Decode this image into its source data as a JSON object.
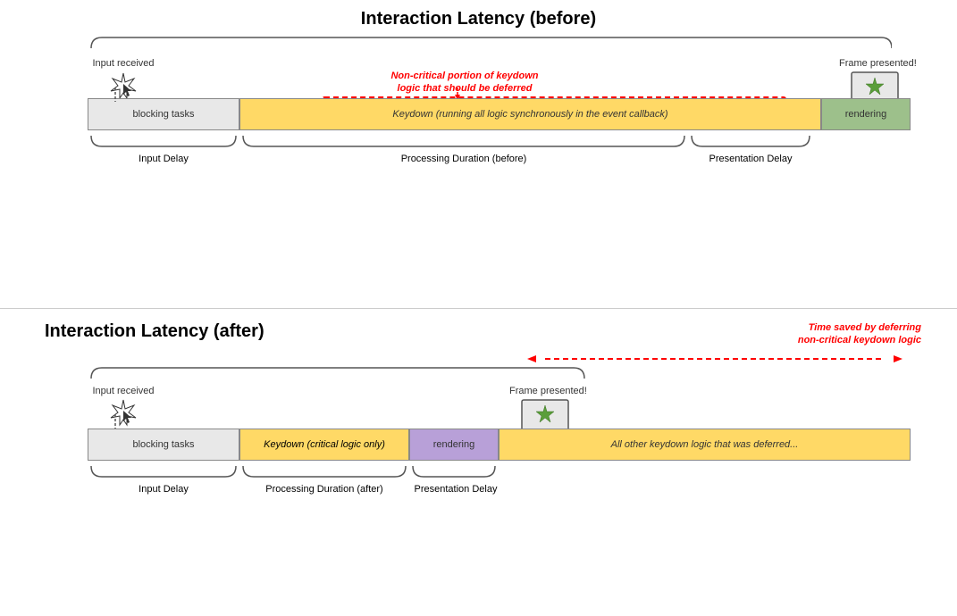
{
  "before": {
    "title": "Interaction Latency (before)",
    "input_received": "Input received",
    "frame_presented": "Frame presented!",
    "blocking_label": "blocking tasks",
    "keydown_label": "Keydown (running all logic synchronously in the event callback)",
    "rendering_label": "rendering",
    "non_critical_label": "Non-critical portion of keydown\nlogic that should be deferred",
    "input_delay_label": "Input Delay",
    "processing_duration_label": "Processing Duration (before)",
    "presentation_delay_label": "Presentation Delay"
  },
  "after": {
    "title": "Interaction Latency (after)",
    "input_received": "Input received",
    "frame_presented": "Frame presented!",
    "blocking_label": "blocking tasks",
    "keydown_label": "Keydown (critical logic only)",
    "rendering_label": "rendering",
    "deferred_label": "All other keydown logic that was deferred...",
    "input_delay_label": "Input Delay",
    "processing_duration_label": "Processing Duration (after)",
    "presentation_delay_label": "Presentation Delay",
    "time_saved_label": "Time saved by deferring\nnon-critical keydown logic"
  },
  "colors": {
    "blocking_bg": "#e8e8e8",
    "keydown_bg": "#ffd966",
    "rendering_bg": "#9dc08b",
    "red": "#cc0000",
    "border": "#555"
  }
}
